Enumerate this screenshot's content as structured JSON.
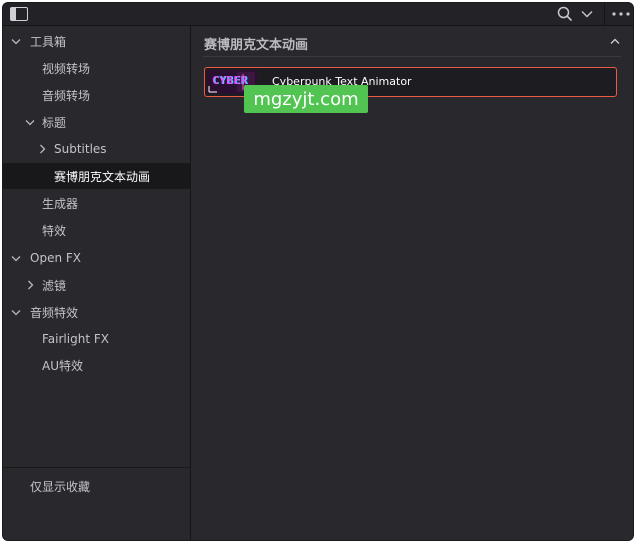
{
  "sidebar": {
    "items": [
      {
        "label": "工具箱",
        "level": 0,
        "chevron": "down"
      },
      {
        "label": "视频转场",
        "level": 1,
        "chevron": "none"
      },
      {
        "label": "音频转场",
        "level": 1,
        "chevron": "none"
      },
      {
        "label": "标题",
        "level": 1,
        "chevron": "down"
      },
      {
        "label": "Subtitles",
        "level": 2,
        "chevron": "right"
      },
      {
        "label": "赛博朋克文本动画",
        "level": 3,
        "chevron": "none",
        "selected": true
      },
      {
        "label": "生成器",
        "level": 1,
        "chevron": "none"
      },
      {
        "label": "特效",
        "level": 1,
        "chevron": "none"
      },
      {
        "label": "Open FX",
        "level": 0,
        "chevron": "down"
      },
      {
        "label": "滤镜",
        "level": 1,
        "chevron": "right"
      },
      {
        "label": "音频特效",
        "level": 0,
        "chevron": "down"
      },
      {
        "label": "Fairlight FX",
        "level": 1,
        "chevron": "none"
      },
      {
        "label": "AU特效",
        "level": 1,
        "chevron": "none"
      }
    ],
    "favorites_toggle": "仅显示收藏"
  },
  "main": {
    "section_title": "赛博朋克文本动画",
    "items": [
      {
        "name": "Cyberpunk Text Animator",
        "thumb_text": "CYBER"
      }
    ]
  },
  "overlay": {
    "watermark": "mgzyjt.com"
  },
  "colors": {
    "background": "#28282d",
    "selected_row": "#18181b",
    "item_border": "#ec5a45",
    "watermark": "#52c452"
  },
  "icons": {
    "panel_toggle": "sidebar-toggle-icon",
    "search": "search-icon",
    "dropdown": "chevron-down-icon",
    "more": "more-options-icon",
    "collapse": "chevron-up-icon"
  }
}
